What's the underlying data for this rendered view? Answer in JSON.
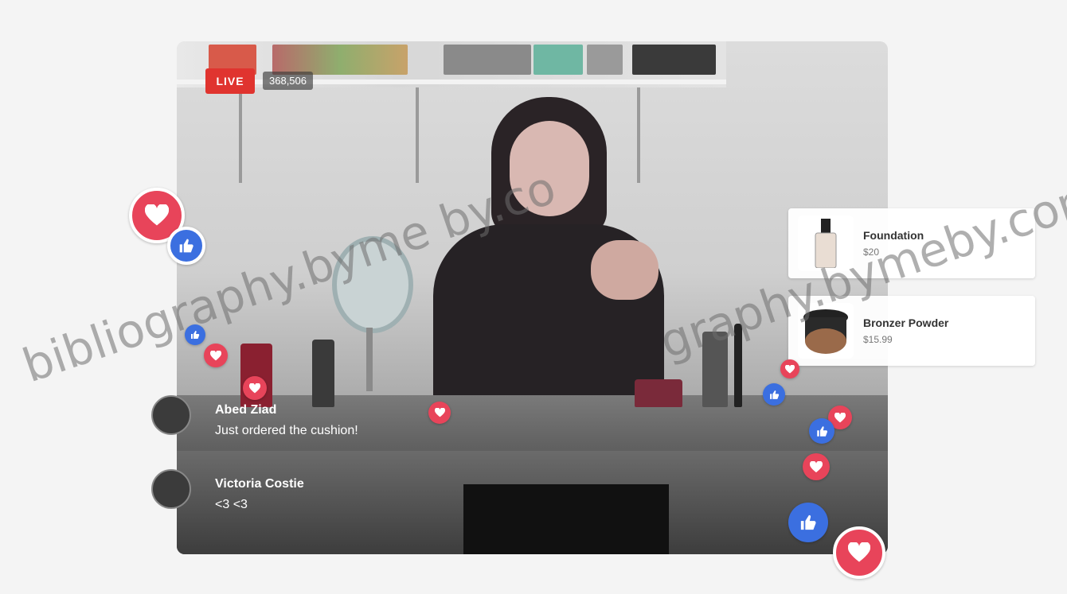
{
  "stream": {
    "live_label": "LIVE",
    "viewer_count": "368,506"
  },
  "comments": [
    {
      "name": "Abed Ziad",
      "message": "Just ordered the cushion!"
    },
    {
      "name": "Victoria Costie",
      "message": "<3 <3"
    }
  ],
  "products": [
    {
      "name": "Foundation",
      "price": "$20",
      "thumb_icon": "foundation-bottle-icon"
    },
    {
      "name": "Bronzer Powder",
      "price": "$15.99",
      "thumb_icon": "compact-powder-icon"
    }
  ],
  "watermark": {
    "text_left": "bibliography.byme by.co",
    "text_right": "graphy.bymeby.com"
  },
  "colors": {
    "live_red": "#e0342f",
    "heart_red": "#e8445a",
    "like_blue": "#3b6fe0"
  }
}
